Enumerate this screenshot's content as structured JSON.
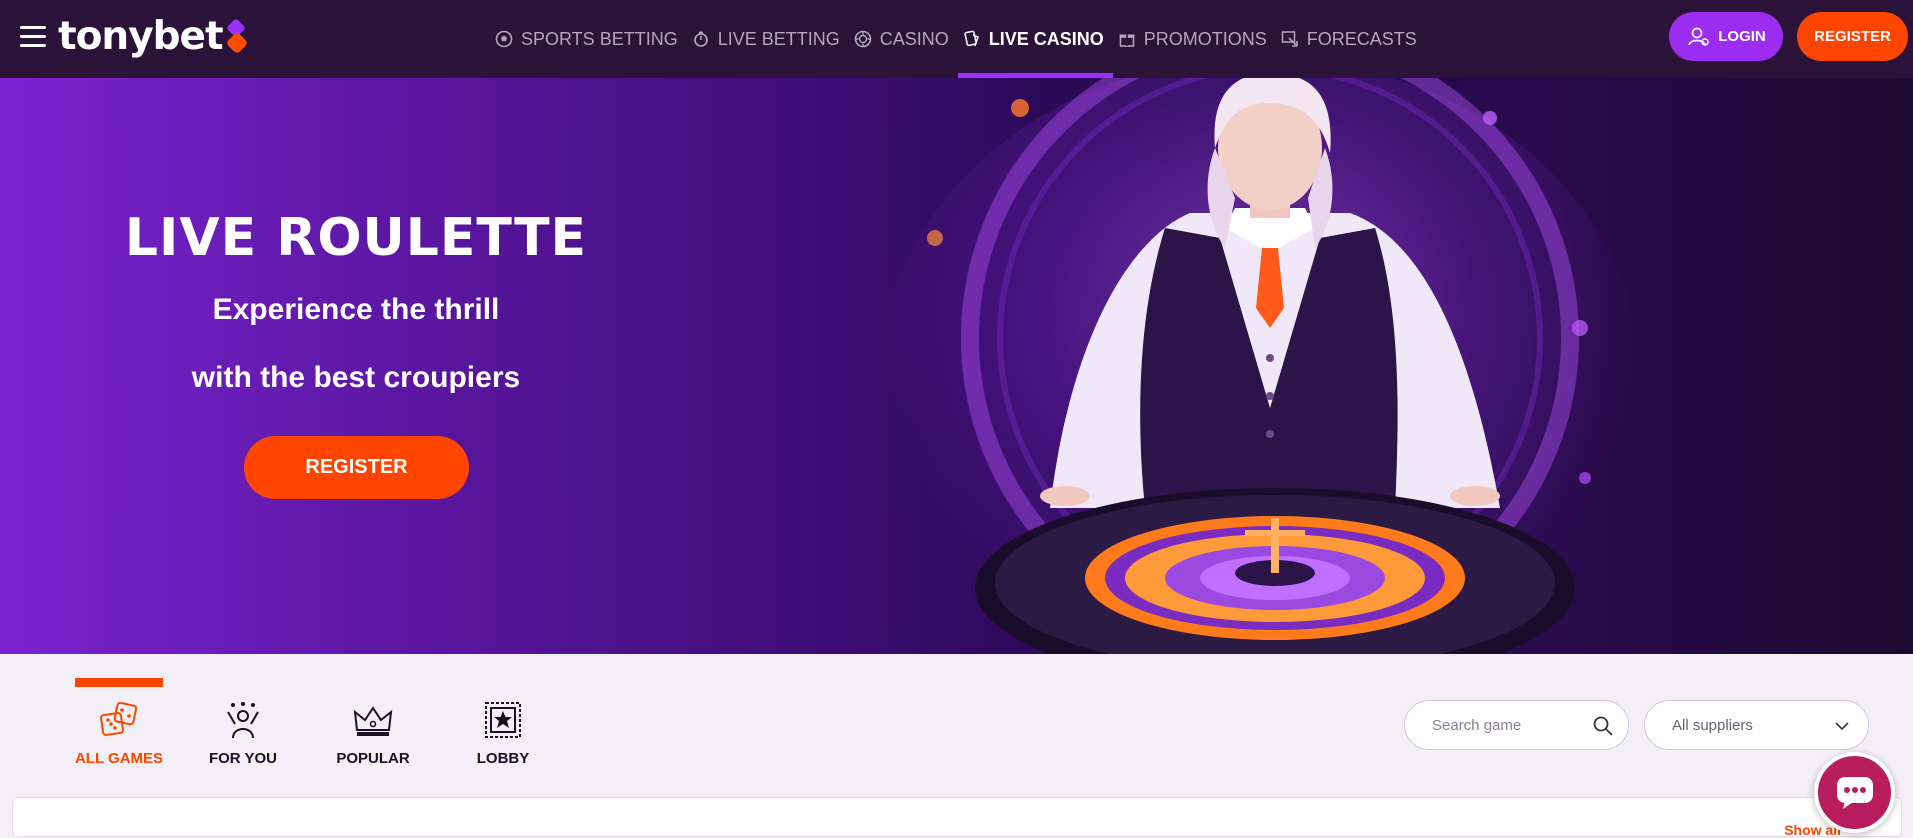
{
  "header": {
    "logo_text": "tonybet",
    "nav": [
      {
        "label": "SPORTS BETTING",
        "icon": "soccer-ball-icon"
      },
      {
        "label": "LIVE BETTING",
        "icon": "stopwatch-icon"
      },
      {
        "label": "CASINO",
        "icon": "casino-chip-icon"
      },
      {
        "label": "LIVE CASINO",
        "icon": "cards-icon",
        "active": true
      },
      {
        "label": "PROMOTIONS",
        "icon": "gift-icon"
      },
      {
        "label": "FORECASTS",
        "icon": "forecast-icon"
      }
    ],
    "login_label": "LOGIN",
    "register_label": "REGISTER"
  },
  "hero": {
    "title": "LIVE ROULETTE",
    "subtitle_line1": "Experience the thrill",
    "subtitle_line2": "with the best croupiers",
    "button_label": "REGISTER"
  },
  "categories": [
    {
      "label": "ALL GAMES",
      "icon": "dice-icon",
      "active": true
    },
    {
      "label": "FOR YOU",
      "icon": "celebrating-person-icon"
    },
    {
      "label": "POPULAR",
      "icon": "crown-icon"
    },
    {
      "label": "LOBBY",
      "icon": "ticket-star-icon"
    }
  ],
  "search": {
    "placeholder": "Search game"
  },
  "supplier_filter": {
    "selected": "All suppliers"
  },
  "panel": {
    "show_all": "Show all"
  },
  "colors": {
    "accent_orange": "#ff4500",
    "accent_purple": "#9b2cf0",
    "header_bg": "#2a1238"
  }
}
